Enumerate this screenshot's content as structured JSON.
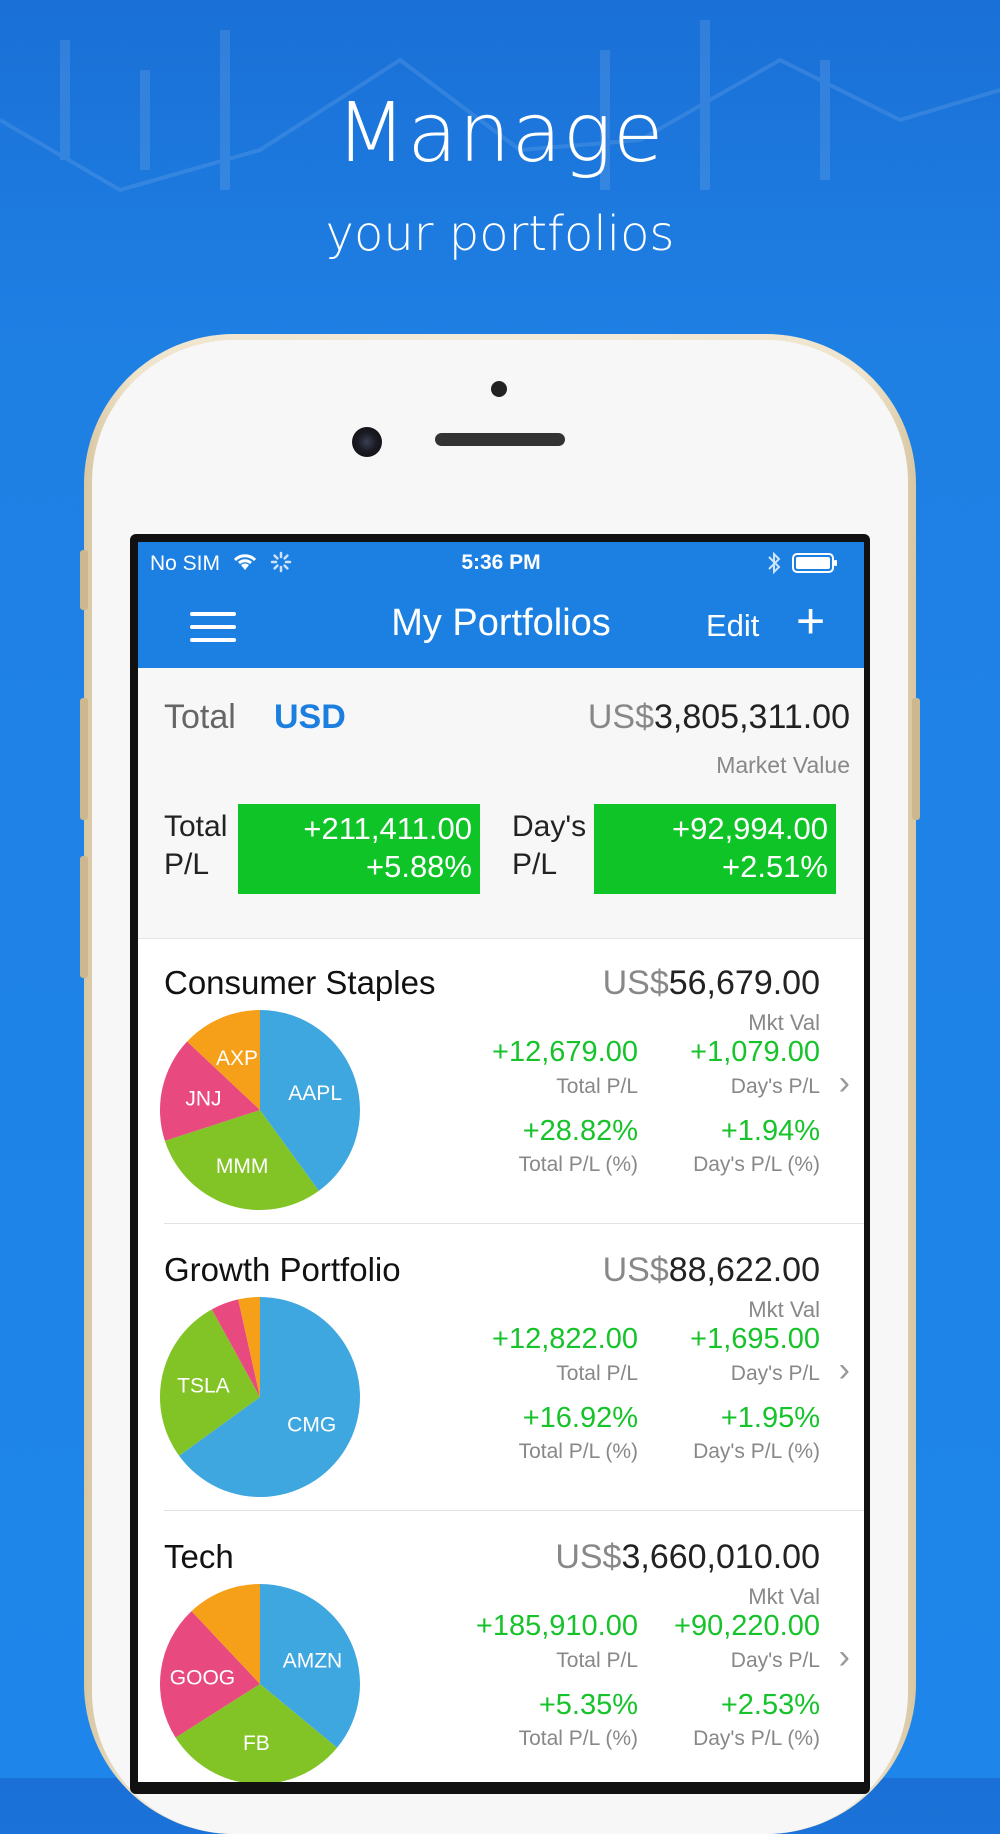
{
  "headline": {
    "title": "Manage",
    "subtitle": "your portfolios"
  },
  "status_bar": {
    "carrier": "No SIM",
    "time": "5:36 PM"
  },
  "nav": {
    "title": "My Portfolios",
    "edit_label": "Edit",
    "add_label": "+"
  },
  "summary": {
    "total_label": "Total",
    "currency": "USD",
    "value_prefix": "US$",
    "value": "3,805,311.00",
    "market_value_label": "Market Value",
    "total_pl_label_1": "Total",
    "total_pl_label_2": "P/L",
    "total_pl_value": "+211,411.00",
    "total_pl_pct": "+5.88%",
    "days_pl_label_1": "Day's",
    "days_pl_label_2": "P/L",
    "days_pl_value": "+92,994.00",
    "days_pl_pct": "+2.51%",
    "positive_color": "#0fc426"
  },
  "portfolios": [
    {
      "name": "Consumer Staples",
      "value_prefix": "US$",
      "value": "56,679.00",
      "mkt_label": "Mkt Val",
      "total_pl": "+12,679.00",
      "total_pl_label": "Total P/L",
      "days_pl": "+1,079.00",
      "days_pl_label": "Day's P/L",
      "total_pl_pct": "+28.82%",
      "total_pl_pct_label": "Total P/L (%)",
      "days_pl_pct": "+1.94%",
      "days_pl_pct_label": "Day's P/L (%)",
      "holdings": [
        {
          "ticker": "AAPL",
          "share": 0.4,
          "color": "#3fa7e0"
        },
        {
          "ticker": "MMM",
          "share": 0.3,
          "color": "#82c325"
        },
        {
          "ticker": "JNJ",
          "share": 0.17,
          "color": "#e84a7f"
        },
        {
          "ticker": "AXP",
          "share": 0.13,
          "color": "#f6a01a"
        }
      ]
    },
    {
      "name": "Growth Portfolio",
      "value_prefix": "US$",
      "value": "88,622.00",
      "mkt_label": "Mkt Val",
      "total_pl": "+12,822.00",
      "total_pl_label": "Total P/L",
      "days_pl": "+1,695.00",
      "days_pl_label": "Day's P/L",
      "total_pl_pct": "+16.92%",
      "total_pl_pct_label": "Total P/L (%)",
      "days_pl_pct": "+1.95%",
      "days_pl_pct_label": "Day's P/L (%)",
      "holdings": [
        {
          "ticker": "CMG",
          "share": 0.65,
          "color": "#3fa7e0"
        },
        {
          "ticker": "TSLA",
          "share": 0.27,
          "color": "#82c325"
        },
        {
          "ticker": "",
          "share": 0.045,
          "color": "#e84a7f"
        },
        {
          "ticker": "",
          "share": 0.035,
          "color": "#f6a01a"
        }
      ]
    },
    {
      "name": "Tech",
      "value_prefix": "US$",
      "value": "3,660,010.00",
      "mkt_label": "Mkt Val",
      "total_pl": "+185,910.00",
      "total_pl_label": "Total P/L",
      "days_pl": "+90,220.00",
      "days_pl_label": "Day's P/L",
      "total_pl_pct": "+5.35%",
      "total_pl_pct_label": "Total P/L (%)",
      "days_pl_pct": "+2.53%",
      "days_pl_pct_label": "Day's P/L (%)",
      "holdings": [
        {
          "ticker": "AMZN",
          "share": 0.36,
          "color": "#3fa7e0"
        },
        {
          "ticker": "FB",
          "share": 0.3,
          "color": "#82c325"
        },
        {
          "ticker": "GOOG",
          "share": 0.22,
          "color": "#e84a7f"
        },
        {
          "ticker": "",
          "share": 0.12,
          "color": "#f6a01a"
        }
      ]
    }
  ]
}
